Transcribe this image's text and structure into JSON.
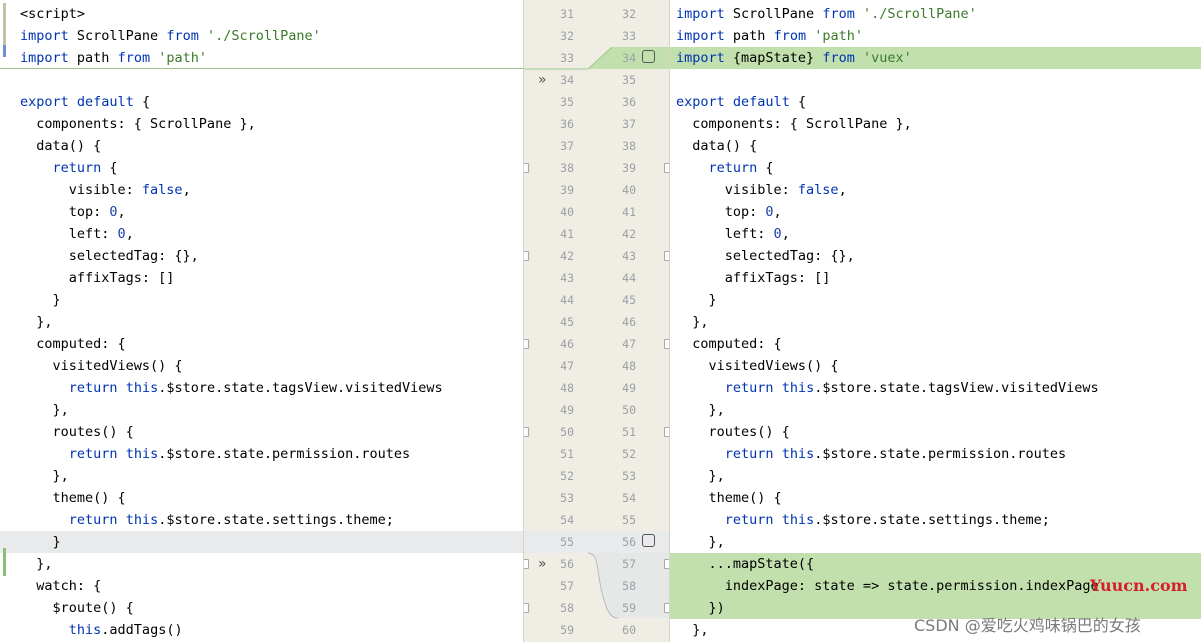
{
  "left": {
    "lines": [
      {
        "text": "<script>"
      },
      {
        "text": "import ScrollPane from './ScrollPane'"
      },
      {
        "text": "import path from 'path'"
      },
      {
        "text": ""
      },
      {
        "text": "export default {"
      },
      {
        "text": "  components: { ScrollPane },"
      },
      {
        "text": "  data() {"
      },
      {
        "text": "    return {"
      },
      {
        "text": "      visible: false,"
      },
      {
        "text": "      top: 0,"
      },
      {
        "text": "      left: 0,"
      },
      {
        "text": "      selectedTag: {},"
      },
      {
        "text": "      affixTags: []"
      },
      {
        "text": "    }"
      },
      {
        "text": "  },"
      },
      {
        "text": "  computed: {"
      },
      {
        "text": "    visitedViews() {"
      },
      {
        "text": "      return this.$store.state.tagsView.visitedViews"
      },
      {
        "text": "    },"
      },
      {
        "text": "    routes() {"
      },
      {
        "text": "      return this.$store.state.permission.routes"
      },
      {
        "text": "    },"
      },
      {
        "text": "    theme() {"
      },
      {
        "text": "      return this.$store.state.settings.theme;"
      },
      {
        "text": "    }"
      },
      {
        "text": "  },"
      },
      {
        "text": "  watch: {"
      },
      {
        "text": "    $route() {"
      },
      {
        "text": "      this.addTags()"
      }
    ]
  },
  "gutter": {
    "left_numbers": [
      "31",
      "32",
      "33",
      "34",
      "35",
      "36",
      "37",
      "38",
      "39",
      "40",
      "41",
      "42",
      "43",
      "44",
      "45",
      "46",
      "47",
      "48",
      "49",
      "50",
      "51",
      "52",
      "53",
      "54",
      "55",
      "56",
      "57",
      "58",
      "59"
    ],
    "right_numbers": [
      "32",
      "33",
      "34",
      "35",
      "36",
      "37",
      "38",
      "39",
      "40",
      "41",
      "42",
      "43",
      "44",
      "45",
      "46",
      "47",
      "48",
      "49",
      "50",
      "51",
      "52",
      "53",
      "54",
      "55",
      "56",
      "57",
      "58",
      "59",
      "60"
    ]
  },
  "right": {
    "lines": [
      {
        "text": "import ScrollPane from './ScrollPane'"
      },
      {
        "text": "import path from 'path'"
      },
      {
        "text": "import {mapState} from 'vuex'"
      },
      {
        "text": ""
      },
      {
        "text": "export default {"
      },
      {
        "text": "  components: { ScrollPane },"
      },
      {
        "text": "  data() {"
      },
      {
        "text": "    return {"
      },
      {
        "text": "      visible: false,"
      },
      {
        "text": "      top: 0,"
      },
      {
        "text": "      left: 0,"
      },
      {
        "text": "      selectedTag: {},"
      },
      {
        "text": "      affixTags: []"
      },
      {
        "text": "    }"
      },
      {
        "text": "  },"
      },
      {
        "text": "  computed: {"
      },
      {
        "text": "    visitedViews() {"
      },
      {
        "text": "      return this.$store.state.tagsView.visitedViews"
      },
      {
        "text": "    },"
      },
      {
        "text": "    routes() {"
      },
      {
        "text": "      return this.$store.state.permission.routes"
      },
      {
        "text": "    },"
      },
      {
        "text": "    theme() {"
      },
      {
        "text": "      return this.$store.state.settings.theme;"
      },
      {
        "text": "    },"
      },
      {
        "text": "    ...mapState({"
      },
      {
        "text": "      indexPage: state => state.permission.indexPage"
      },
      {
        "text": "    })"
      },
      {
        "text": "  },"
      }
    ]
  },
  "watermarks": {
    "site": "Yuucn.com",
    "author": "CSDN @爱吃火鸡味锅巴的女孩"
  },
  "colors": {
    "added_line": "#c2e0ad",
    "gutter_bg": "#f0ede4",
    "current_line": "#e9eaeb"
  },
  "icons": [
    "apply-change-chevron-icon",
    "checkbox-icon",
    "fold-marker-icon"
  ]
}
